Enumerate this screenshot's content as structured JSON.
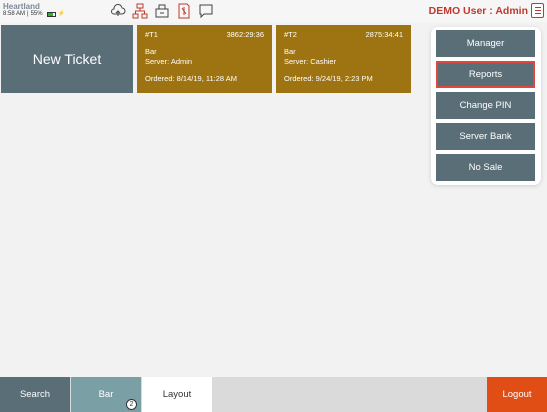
{
  "status": {
    "brand": "Heartland",
    "time": "8:58 AM",
    "separator": "|",
    "battery": "55%"
  },
  "toolbar": {
    "icons": [
      "cloud-sync-icon",
      "network-icon",
      "cash-drawer-icon",
      "receipt-icon",
      "message-icon"
    ]
  },
  "header": {
    "user_label": "DEMO User : Admin",
    "menu_icon": "menu-icon"
  },
  "tickets": {
    "new_ticket_label": "New Ticket",
    "items": [
      {
        "id": "#T1",
        "timer": "3862:29:36",
        "area": "Bar",
        "server": "Server: Admin",
        "ordered": "Ordered: 8/14/19, 11:28 AM"
      },
      {
        "id": "#T2",
        "timer": "2875:34:41",
        "area": "Bar",
        "server": "Server: Cashier",
        "ordered": "Ordered: 9/24/19, 2:23 PM"
      }
    ]
  },
  "menu": {
    "items": [
      "Manager",
      "Reports",
      "Change PIN",
      "Server Bank",
      "No Sale"
    ],
    "highlighted": "Reports"
  },
  "bottom": {
    "search_label": "Search",
    "bar_label": "Bar",
    "bar_badge": "2",
    "layout_label": "Layout",
    "logout_label": "Logout"
  },
  "colors": {
    "slate": "#5a6e78",
    "ticket": "#9e7412",
    "accent_red": "#c0392b",
    "logout": "#e04e16",
    "bar_tab": "#7aa0a6"
  }
}
